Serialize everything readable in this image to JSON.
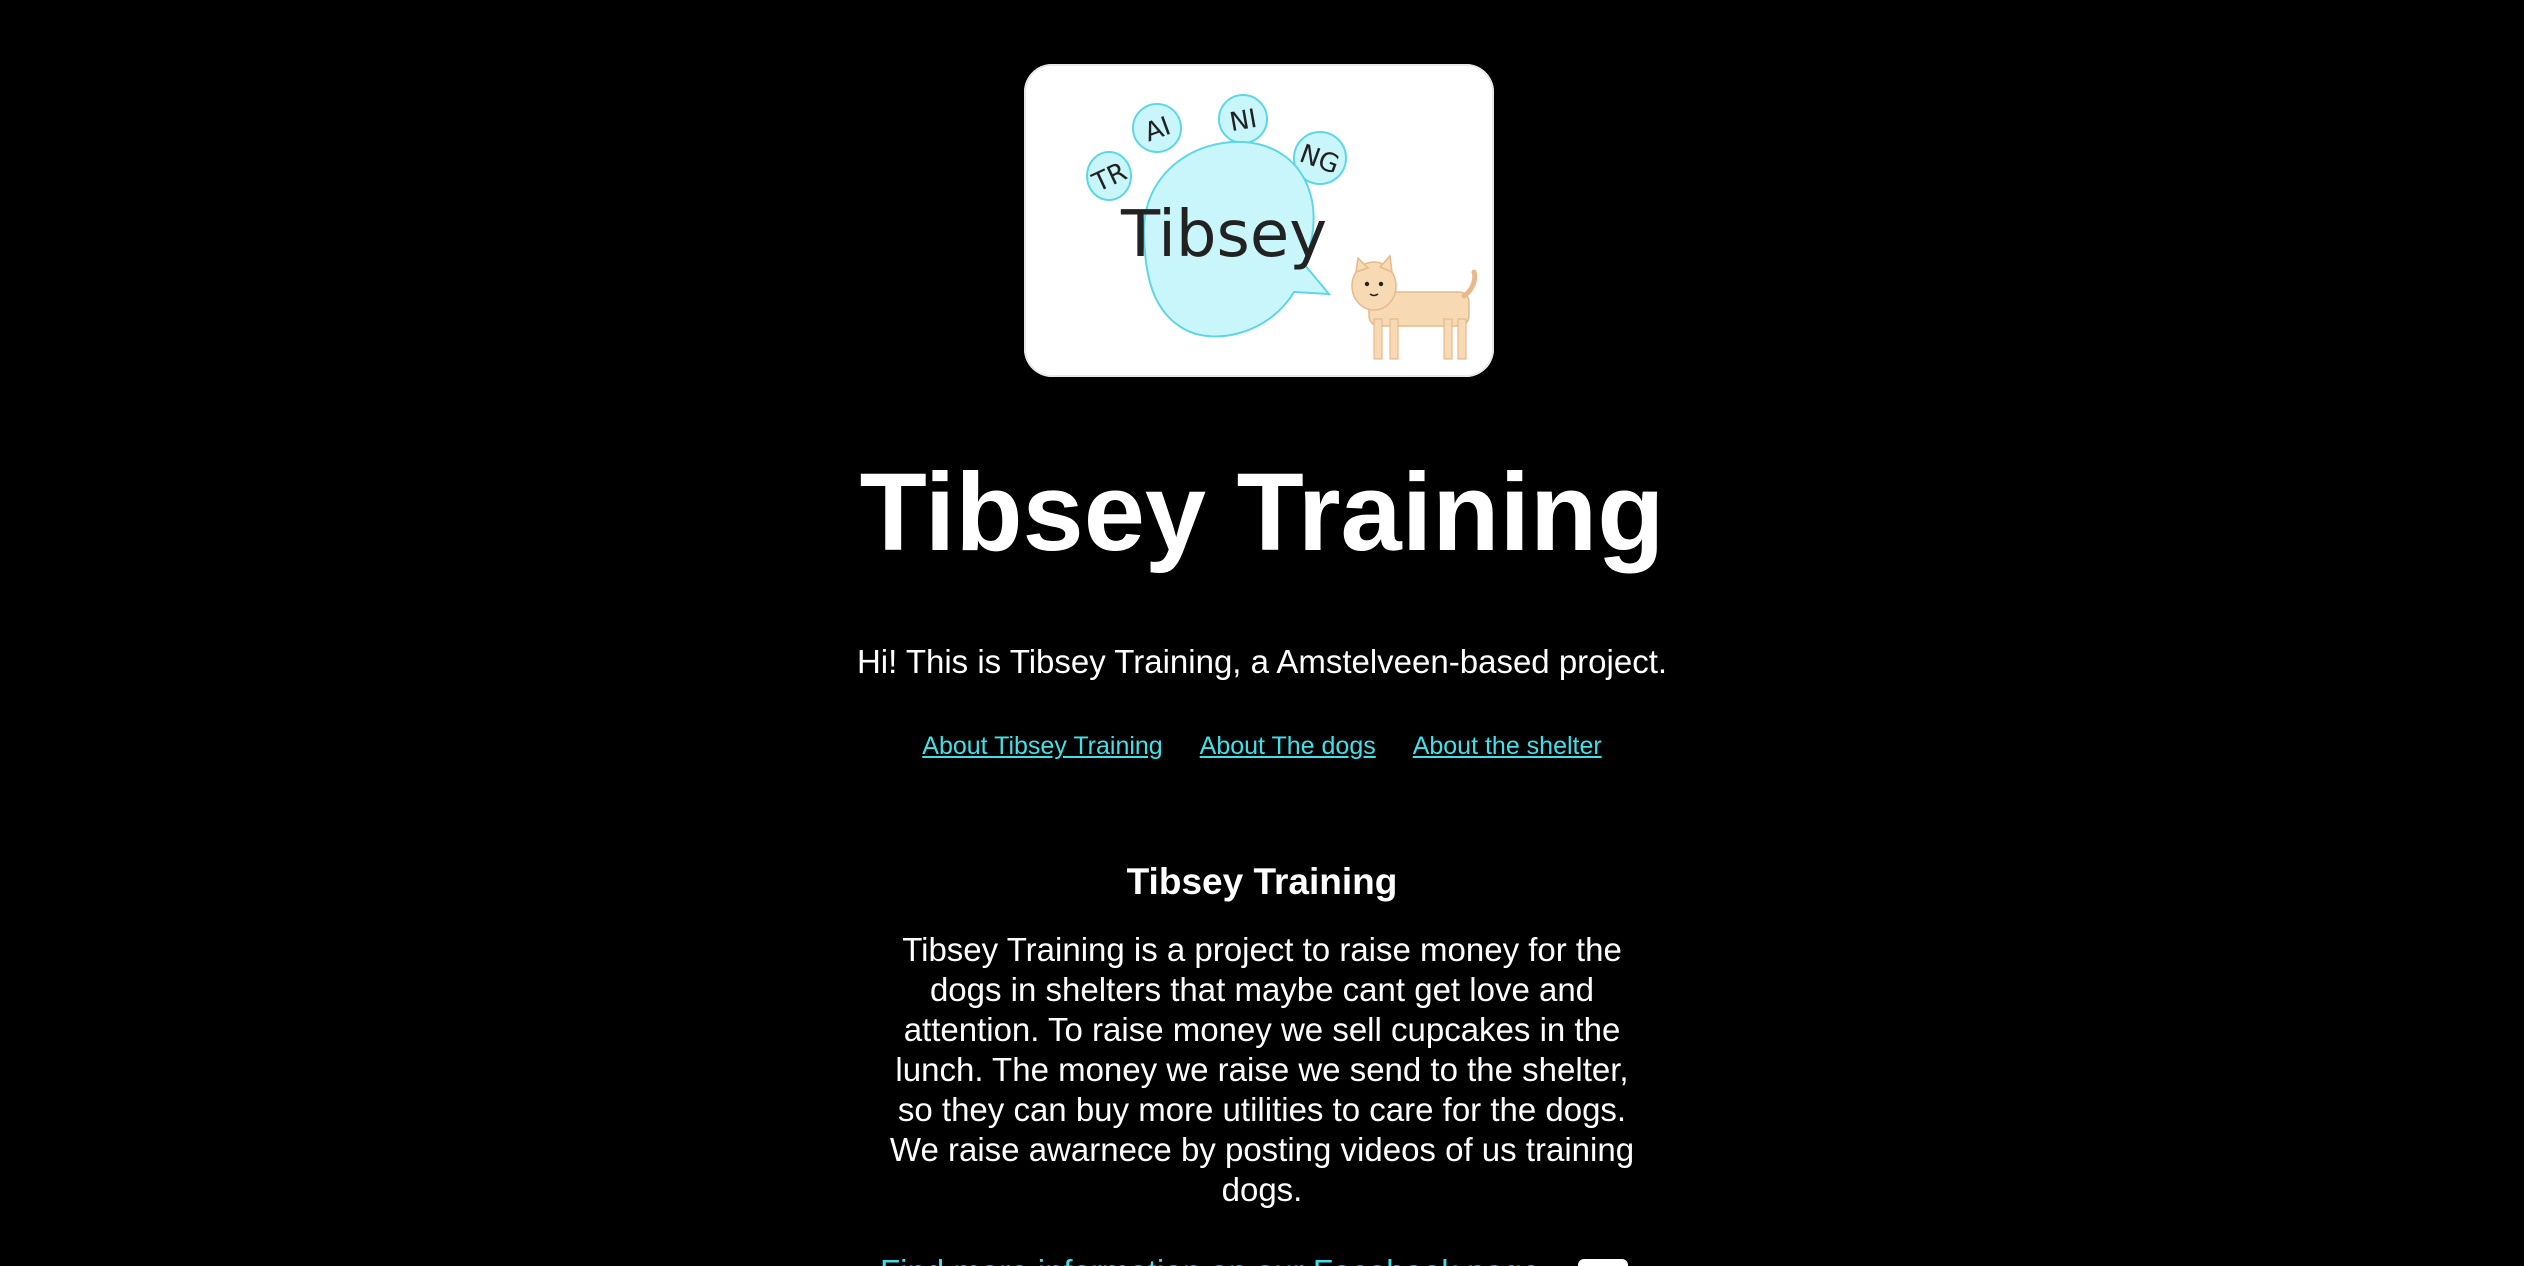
{
  "logo": {
    "paw_letters": [
      "TR",
      "AI",
      "NI",
      "NG"
    ],
    "name": "Tibsey"
  },
  "site_title": "Tibsey Training",
  "intro_text": "Hi! This is Tibsey Training, a Amstelveen-based project.",
  "nav": {
    "links": [
      "About Tibsey Training",
      "About The dogs",
      "About the shelter"
    ]
  },
  "section": {
    "title": "Tibsey Training",
    "body": "Tibsey Training is a project to raise money for the dogs in shelters that maybe cant get love and attention. To raise money we sell cupcakes in the lunch. The money we raise we send to the shelter, so they can buy more utilities to care for the dogs. We raise awarnece by posting videos of us training dogs."
  },
  "more_links": {
    "info_label": "Find more information on our Facebook page"
  },
  "colors": {
    "background": "#000000",
    "text": "#ffffff",
    "link": "#40e0e8",
    "bubble": "#c8f6fa",
    "bubble_stroke": "#5fd6e6",
    "dog": "#f7d9b4"
  }
}
